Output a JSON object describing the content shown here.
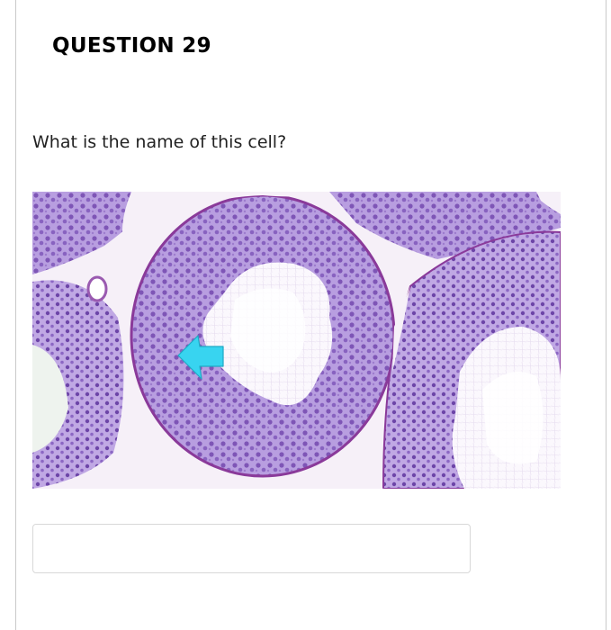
{
  "question": {
    "title": "QUESTION 29",
    "prompt": "What is the name of this cell?"
  },
  "image": {
    "subject": "histology-micrograph",
    "pointer_icon": "arrow-left-icon",
    "colors": {
      "background": "#f6f0f8",
      "tissue": "#a98ed6",
      "nuclei": "#7a4fb0",
      "membrane": "#8a3a9a",
      "arrow": "#3ad6f0"
    }
  },
  "answer": {
    "value": "",
    "placeholder": ""
  }
}
